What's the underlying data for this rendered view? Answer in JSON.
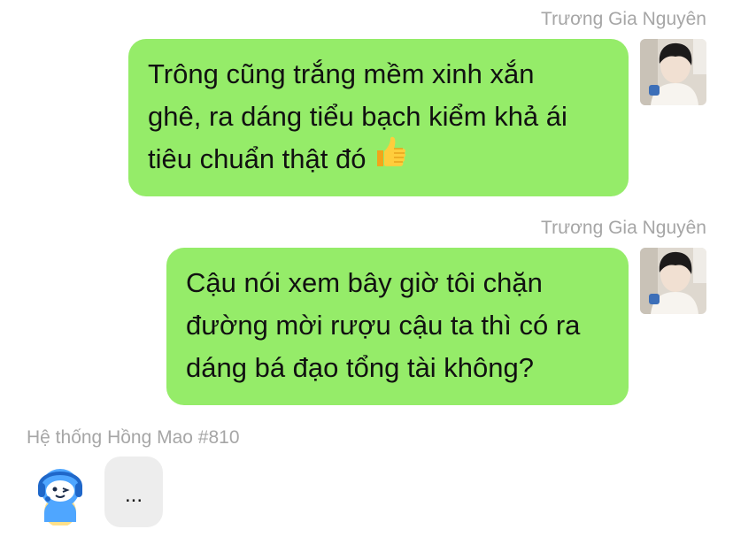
{
  "messages": [
    {
      "sender": "Trương Gia Nguyên",
      "lines": [
        "Trông cũng trắng mềm xinh xắn",
        "ghê, ra dáng tiểu bạch kiểm khả ái",
        "tiêu chuẩn thật đó"
      ],
      "emoji": "thumbs-up-icon"
    },
    {
      "sender": "Trương Gia Nguyên",
      "lines": [
        "Cậu nói xem bây giờ tôi chặn",
        "đường mời rượu cậu ta thì có ra",
        "dáng bá đạo tổng tài không?"
      ]
    },
    {
      "sender": "Hệ thống Hồng Mao #810",
      "text": "..."
    }
  ],
  "colors": {
    "outgoing_bubble": "#95ec69",
    "incoming_bubble": "#ededed",
    "sender_name": "#a6a6a6"
  }
}
